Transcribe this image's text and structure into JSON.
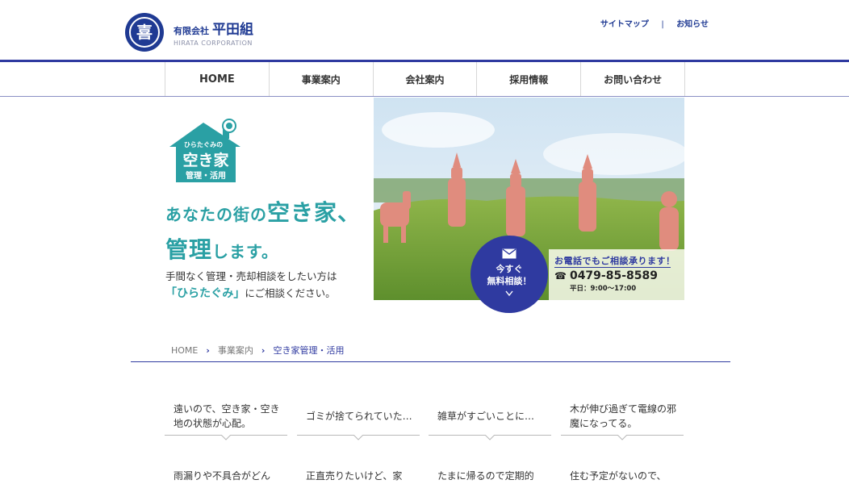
{
  "header": {
    "company_prefix": "有限会社",
    "company_name": "平田組",
    "company_roman": "HIRATA CORPORATION",
    "logo_glyph": "喜",
    "util_links": [
      "サイトマップ",
      "お知らせ"
    ],
    "util_separator": "|"
  },
  "nav": {
    "items": [
      "HOME",
      "事業案内",
      "会社案内",
      "採用情報",
      "お問い合わせ"
    ]
  },
  "hero": {
    "badge": {
      "small": "ひらたぐみの",
      "main": "空き家",
      "sub": "管理・活用"
    },
    "headline_1a": "あなたの街の",
    "headline_1b": "空き家、",
    "headline_2a": "管理",
    "headline_2b": "します。",
    "lead_1": "手間なく管理・売却相談をしたい方は",
    "lead_2a": "「ひらたぐみ」",
    "lead_2b": "にご相談ください。",
    "consult_1": "今すぐ",
    "consult_2": "無料相談！",
    "contact_head": "お電話でもご相談承ります！",
    "tel": "0479-85-8589",
    "hours": "平日：9:00〜17:00"
  },
  "breadcrumb": [
    "HOME",
    "事業案内",
    "空き家管理・活用"
  ],
  "worries": [
    "遠いので、空き家・空き地の状態が心配。",
    "ゴミが捨てられていた…",
    "雑草がすごいことに…",
    "木が伸び過ぎて電線の邪魔になってる。",
    "雨漏りや不具合がどん",
    "正直売りたいけど、家",
    "たまに帰るので定期的",
    "住む予定がないので、"
  ],
  "colors": {
    "brand": "#2f3aa0",
    "teal": "#2aa0a4"
  }
}
